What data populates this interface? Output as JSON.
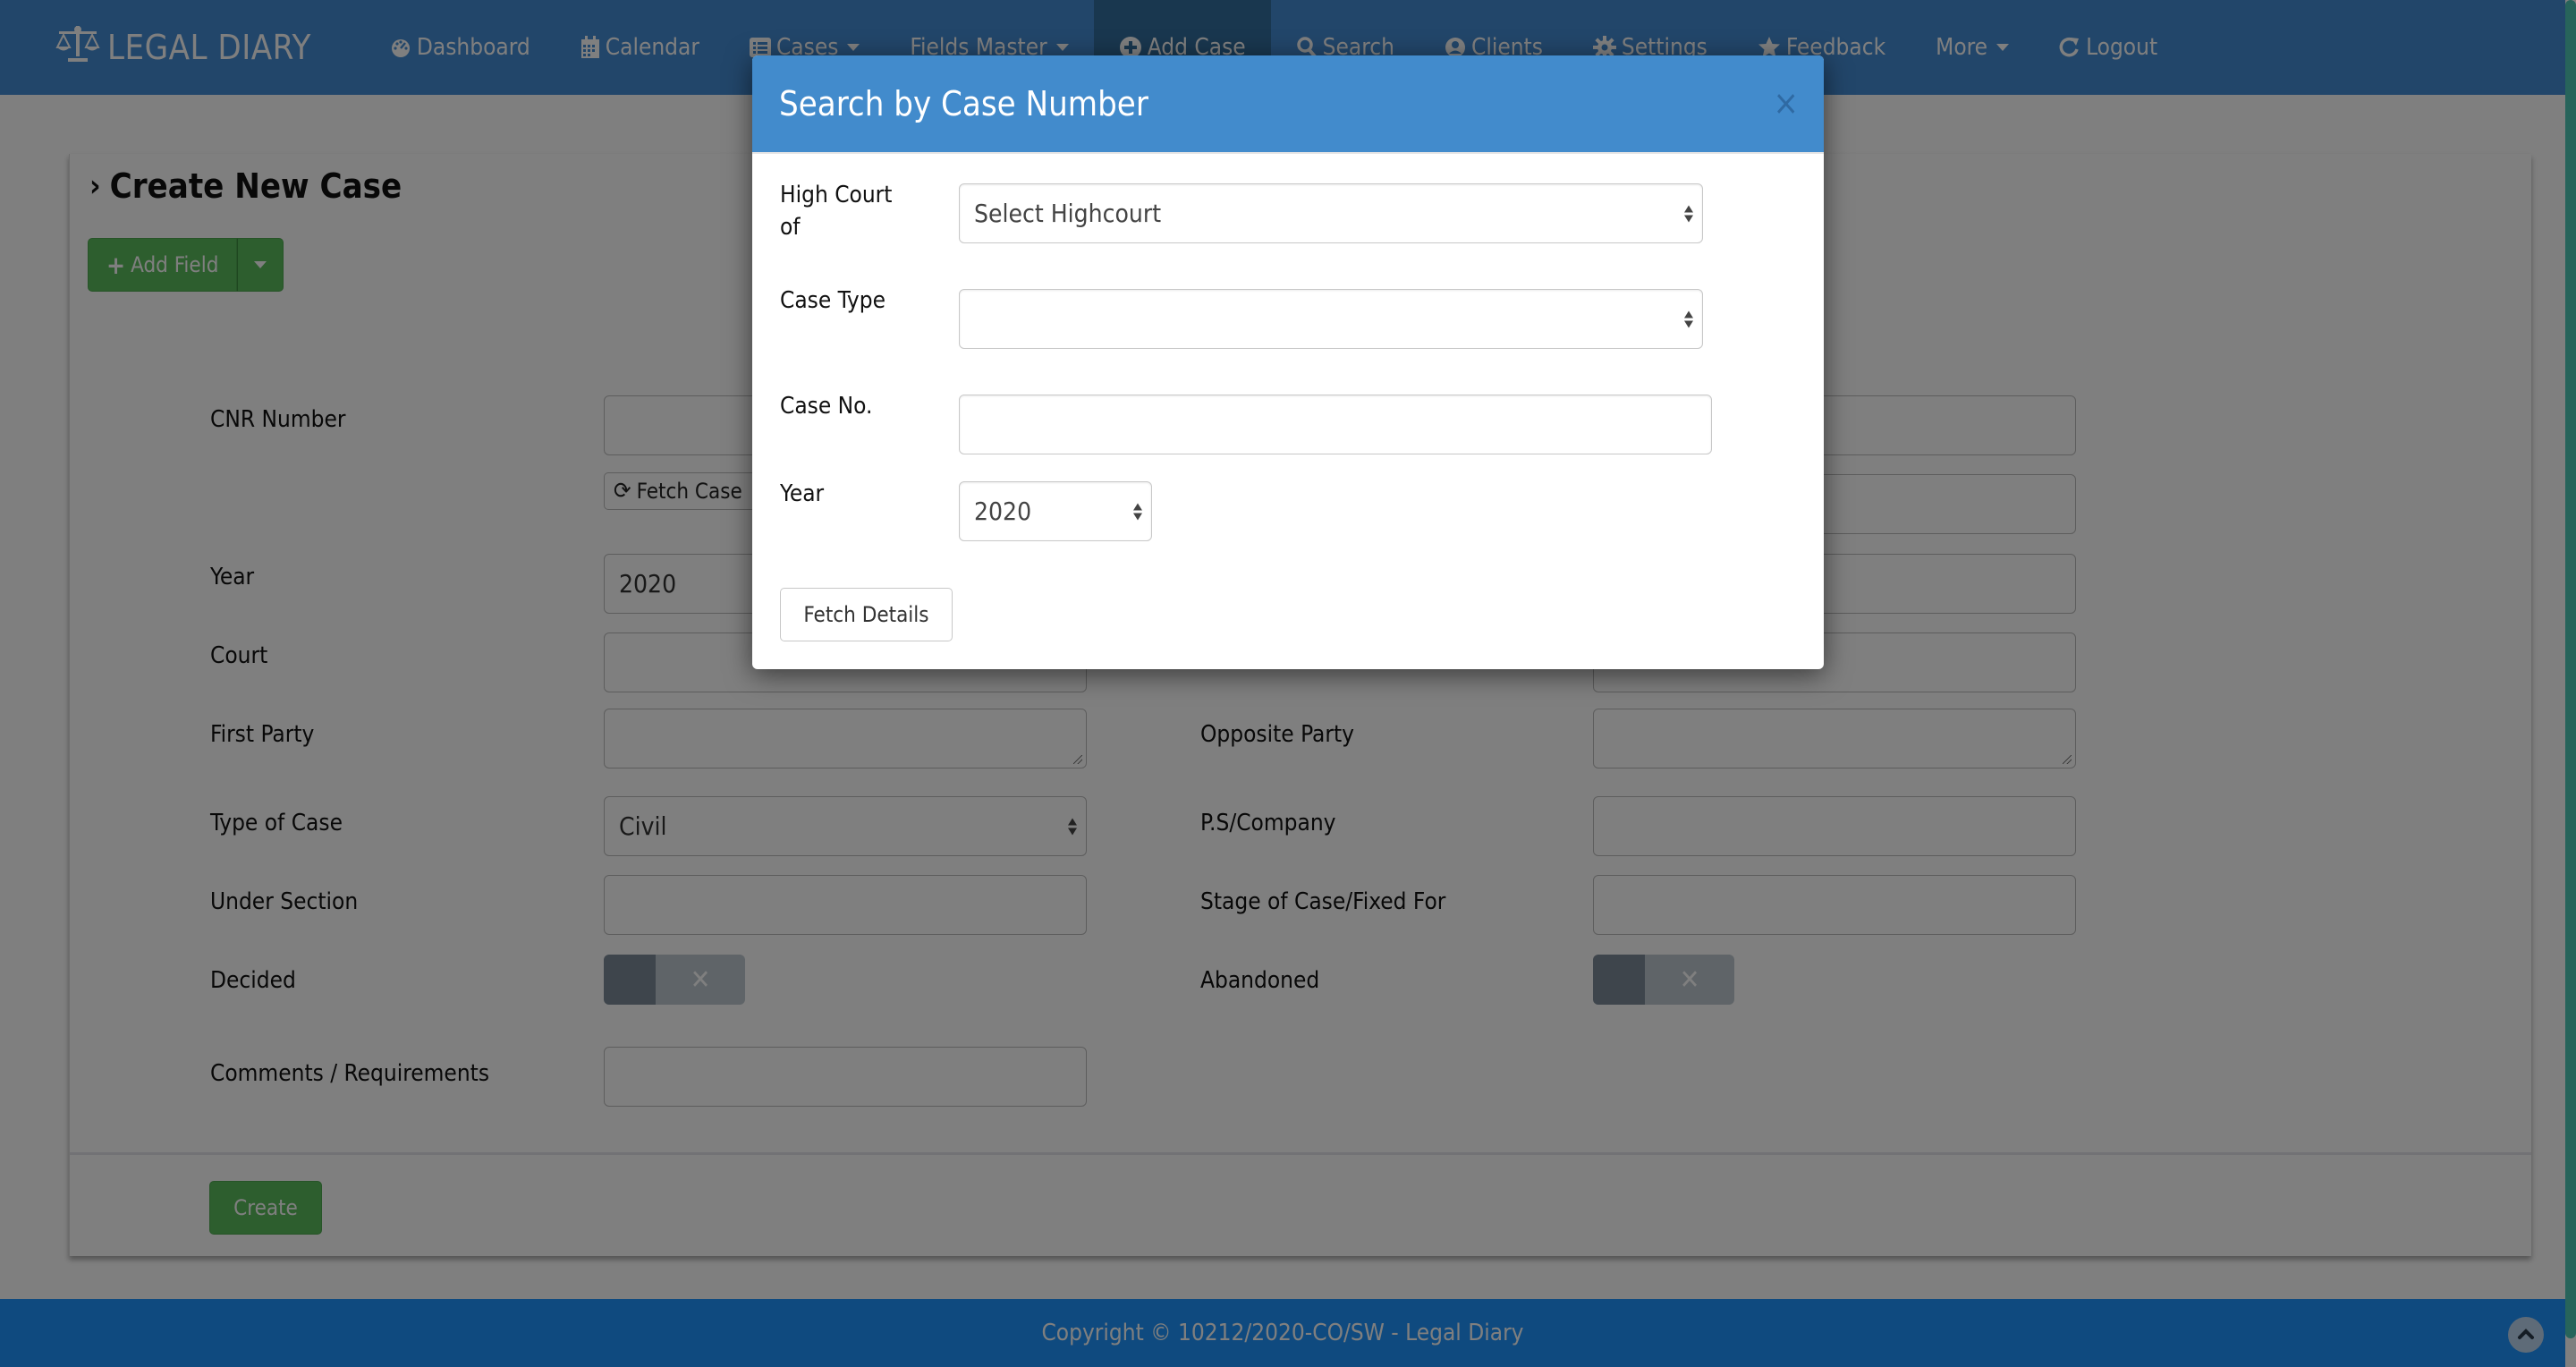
{
  "navbar": {
    "brand": "LEGAL DIARY",
    "items": [
      {
        "label": "Dashboard",
        "icon": "tachometer-icon"
      },
      {
        "label": "Calendar",
        "icon": "calendar-icon"
      },
      {
        "label": "Cases",
        "icon": "list-icon",
        "dropdown": true
      },
      {
        "label": "Fields Master",
        "dropdown": true
      },
      {
        "label": "Add Case",
        "icon": "plus-circle-icon",
        "active": true
      },
      {
        "label": "Search",
        "icon": "search-icon"
      },
      {
        "label": "Clients",
        "icon": "user-circle-icon"
      },
      {
        "label": "Settings",
        "icon": "gear-icon"
      },
      {
        "label": "Feedback",
        "icon": "star-icon"
      },
      {
        "label": "More",
        "dropdown": true
      },
      {
        "label": "Logout",
        "icon": "logout-icon"
      }
    ]
  },
  "page": {
    "title": "Create New Case",
    "add_field_label": "Add Field",
    "fetch_case_label": "Fetch Case",
    "create_label": "Create",
    "form": {
      "cnr_number": {
        "label": "CNR Number",
        "value": ""
      },
      "year": {
        "label": "Year",
        "value": "2020"
      },
      "court": {
        "label": "Court",
        "value": ""
      },
      "first_party": {
        "label": "First Party",
        "value": ""
      },
      "opposite_party": {
        "label": "Opposite Party",
        "value": ""
      },
      "type_of_case": {
        "label": "Type of Case",
        "value": "Civil"
      },
      "ps_company": {
        "label": "P.S/Company",
        "value": ""
      },
      "under_section": {
        "label": "Under Section",
        "value": ""
      },
      "stage_of_case": {
        "label": "Stage of Case/Fixed For",
        "value": ""
      },
      "decided": {
        "label": "Decided",
        "checked": false
      },
      "abandoned": {
        "label": "Abandoned",
        "checked": false
      },
      "comments": {
        "label": "Comments / Requirements",
        "value": ""
      }
    }
  },
  "modal": {
    "title": "Search by Case Number",
    "close_symbol": "×",
    "high_court": {
      "label": "High Court of",
      "value": "Select Highcourt"
    },
    "case_type": {
      "label": "Case Type",
      "value": ""
    },
    "case_no": {
      "label": "Case No.",
      "value": ""
    },
    "year": {
      "label": "Year",
      "value": "2020"
    },
    "fetch_details_label": "Fetch Details"
  },
  "footer": {
    "text": "Copyright © 10212/2020-CO/SW - Legal Diary"
  },
  "colors": {
    "navbar": "#448cd4",
    "modal_header": "#428bcc",
    "success": "#5abc5c",
    "footer": "#1e94ff",
    "scrollbar": "#4ec9b6"
  }
}
